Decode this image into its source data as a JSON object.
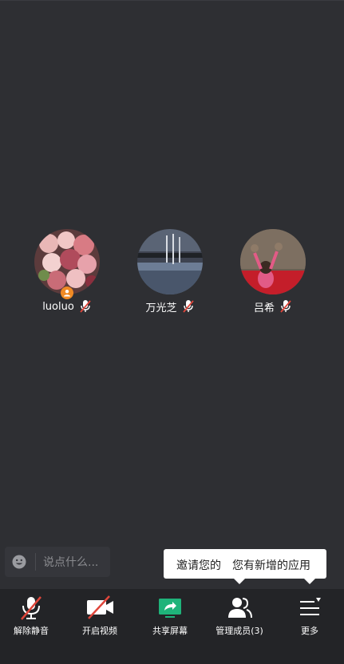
{
  "participants": [
    {
      "name": "luoluo",
      "is_host": true,
      "muted": true
    },
    {
      "name": "万光芝",
      "is_host": false,
      "muted": true
    },
    {
      "name": "吕希",
      "is_host": false,
      "muted": true
    }
  ],
  "chat": {
    "placeholder": "说点什么..."
  },
  "tooltip": {
    "text_back": "邀请您的",
    "text_front": "您有新增的应用"
  },
  "toolbar": {
    "unmute_label": "解除静音",
    "video_label": "开启视频",
    "share_label": "共享屏幕",
    "members_label": "管理成员(3)",
    "more_label": "更多"
  },
  "colors": {
    "background": "#2e2f33",
    "toolbar": "#232427",
    "mute_red": "#e0463b",
    "share_green": "#1fb37a",
    "host_orange": "#f08a24"
  },
  "icons": [
    "mic-off-icon",
    "video-off-icon",
    "share-screen-icon",
    "members-icon",
    "more-menu-icon",
    "emoji-icon",
    "host-badge-icon"
  ]
}
